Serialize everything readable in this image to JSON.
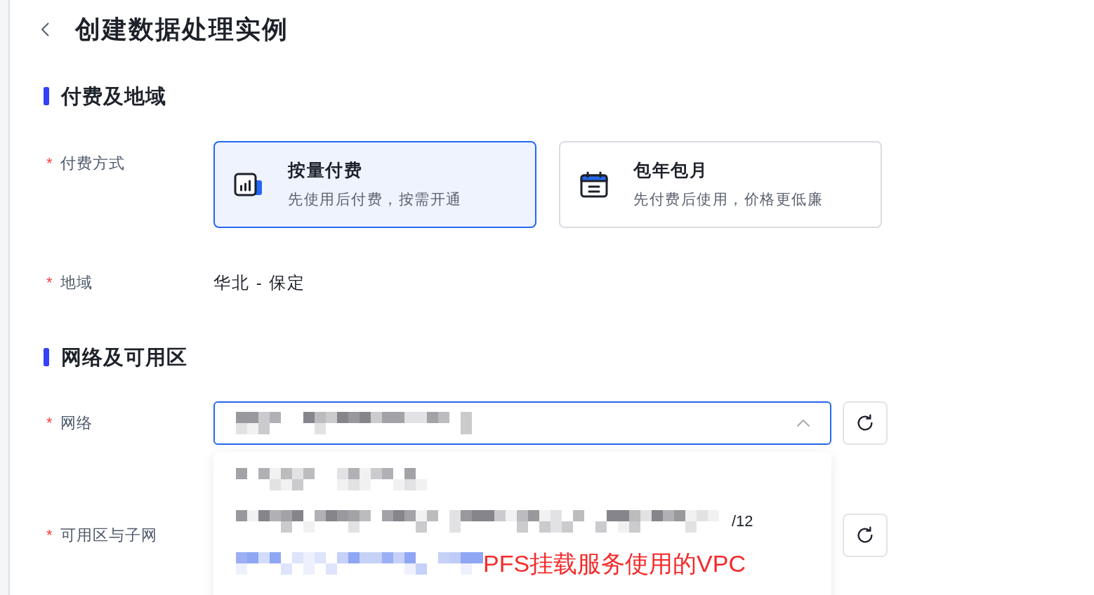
{
  "header": {
    "title": "创建数据处理实例"
  },
  "sections": [
    {
      "title": "付费及地域",
      "fields": [
        {
          "kind": "cards",
          "required_mark": "*",
          "label": "付费方式",
          "options": [
            {
              "title": "按量付费",
              "description": "先使用后付费，按需开通",
              "selected": true
            },
            {
              "title": "包年包月",
              "description": "先付费后使用，价格更低廉",
              "selected": false
            }
          ]
        },
        {
          "kind": "text",
          "required_mark": "*",
          "label": "地域",
          "value": "华北 - 保定"
        }
      ]
    },
    {
      "title": "网络及可用区",
      "fields": [
        {
          "kind": "select",
          "required_mark": "*",
          "label": "网络",
          "expanded": true,
          "options": [
            {
              "selected": false
            },
            {
              "text": "/12",
              "selected": false
            },
            {
              "annotation": "PFS挂载服务使用的VPC",
              "selected": true
            }
          ]
        },
        {
          "kind": "select",
          "required_mark": "*",
          "label": "可用区与子网"
        }
      ]
    }
  ]
}
